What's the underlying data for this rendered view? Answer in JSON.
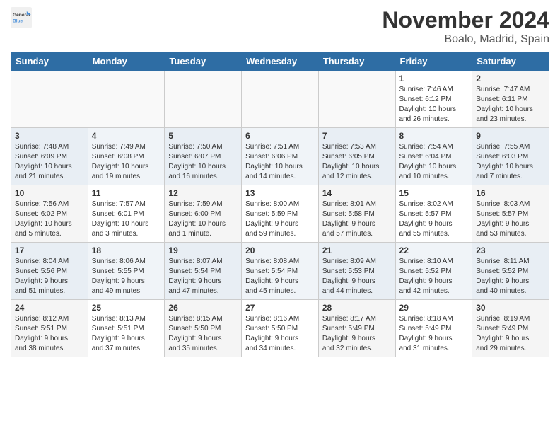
{
  "logo": {
    "text_general": "General",
    "text_blue": "Blue"
  },
  "title": "November 2024",
  "location": "Boalo, Madrid, Spain",
  "weekdays": [
    "Sunday",
    "Monday",
    "Tuesday",
    "Wednesday",
    "Thursday",
    "Friday",
    "Saturday"
  ],
  "weeks": [
    [
      {
        "day": "",
        "info": ""
      },
      {
        "day": "",
        "info": ""
      },
      {
        "day": "",
        "info": ""
      },
      {
        "day": "",
        "info": ""
      },
      {
        "day": "",
        "info": ""
      },
      {
        "day": "1",
        "info": "Sunrise: 7:46 AM\nSunset: 6:12 PM\nDaylight: 10 hours\nand 26 minutes."
      },
      {
        "day": "2",
        "info": "Sunrise: 7:47 AM\nSunset: 6:11 PM\nDaylight: 10 hours\nand 23 minutes."
      }
    ],
    [
      {
        "day": "3",
        "info": "Sunrise: 7:48 AM\nSunset: 6:09 PM\nDaylight: 10 hours\nand 21 minutes."
      },
      {
        "day": "4",
        "info": "Sunrise: 7:49 AM\nSunset: 6:08 PM\nDaylight: 10 hours\nand 19 minutes."
      },
      {
        "day": "5",
        "info": "Sunrise: 7:50 AM\nSunset: 6:07 PM\nDaylight: 10 hours\nand 16 minutes."
      },
      {
        "day": "6",
        "info": "Sunrise: 7:51 AM\nSunset: 6:06 PM\nDaylight: 10 hours\nand 14 minutes."
      },
      {
        "day": "7",
        "info": "Sunrise: 7:53 AM\nSunset: 6:05 PM\nDaylight: 10 hours\nand 12 minutes."
      },
      {
        "day": "8",
        "info": "Sunrise: 7:54 AM\nSunset: 6:04 PM\nDaylight: 10 hours\nand 10 minutes."
      },
      {
        "day": "9",
        "info": "Sunrise: 7:55 AM\nSunset: 6:03 PM\nDaylight: 10 hours\nand 7 minutes."
      }
    ],
    [
      {
        "day": "10",
        "info": "Sunrise: 7:56 AM\nSunset: 6:02 PM\nDaylight: 10 hours\nand 5 minutes."
      },
      {
        "day": "11",
        "info": "Sunrise: 7:57 AM\nSunset: 6:01 PM\nDaylight: 10 hours\nand 3 minutes."
      },
      {
        "day": "12",
        "info": "Sunrise: 7:59 AM\nSunset: 6:00 PM\nDaylight: 10 hours\nand 1 minute."
      },
      {
        "day": "13",
        "info": "Sunrise: 8:00 AM\nSunset: 5:59 PM\nDaylight: 9 hours\nand 59 minutes."
      },
      {
        "day": "14",
        "info": "Sunrise: 8:01 AM\nSunset: 5:58 PM\nDaylight: 9 hours\nand 57 minutes."
      },
      {
        "day": "15",
        "info": "Sunrise: 8:02 AM\nSunset: 5:57 PM\nDaylight: 9 hours\nand 55 minutes."
      },
      {
        "day": "16",
        "info": "Sunrise: 8:03 AM\nSunset: 5:57 PM\nDaylight: 9 hours\nand 53 minutes."
      }
    ],
    [
      {
        "day": "17",
        "info": "Sunrise: 8:04 AM\nSunset: 5:56 PM\nDaylight: 9 hours\nand 51 minutes."
      },
      {
        "day": "18",
        "info": "Sunrise: 8:06 AM\nSunset: 5:55 PM\nDaylight: 9 hours\nand 49 minutes."
      },
      {
        "day": "19",
        "info": "Sunrise: 8:07 AM\nSunset: 5:54 PM\nDaylight: 9 hours\nand 47 minutes."
      },
      {
        "day": "20",
        "info": "Sunrise: 8:08 AM\nSunset: 5:54 PM\nDaylight: 9 hours\nand 45 minutes."
      },
      {
        "day": "21",
        "info": "Sunrise: 8:09 AM\nSunset: 5:53 PM\nDaylight: 9 hours\nand 44 minutes."
      },
      {
        "day": "22",
        "info": "Sunrise: 8:10 AM\nSunset: 5:52 PM\nDaylight: 9 hours\nand 42 minutes."
      },
      {
        "day": "23",
        "info": "Sunrise: 8:11 AM\nSunset: 5:52 PM\nDaylight: 9 hours\nand 40 minutes."
      }
    ],
    [
      {
        "day": "24",
        "info": "Sunrise: 8:12 AM\nSunset: 5:51 PM\nDaylight: 9 hours\nand 38 minutes."
      },
      {
        "day": "25",
        "info": "Sunrise: 8:13 AM\nSunset: 5:51 PM\nDaylight: 9 hours\nand 37 minutes."
      },
      {
        "day": "26",
        "info": "Sunrise: 8:15 AM\nSunset: 5:50 PM\nDaylight: 9 hours\nand 35 minutes."
      },
      {
        "day": "27",
        "info": "Sunrise: 8:16 AM\nSunset: 5:50 PM\nDaylight: 9 hours\nand 34 minutes."
      },
      {
        "day": "28",
        "info": "Sunrise: 8:17 AM\nSunset: 5:49 PM\nDaylight: 9 hours\nand 32 minutes."
      },
      {
        "day": "29",
        "info": "Sunrise: 8:18 AM\nSunset: 5:49 PM\nDaylight: 9 hours\nand 31 minutes."
      },
      {
        "day": "30",
        "info": "Sunrise: 8:19 AM\nSunset: 5:49 PM\nDaylight: 9 hours\nand 29 minutes."
      }
    ]
  ]
}
